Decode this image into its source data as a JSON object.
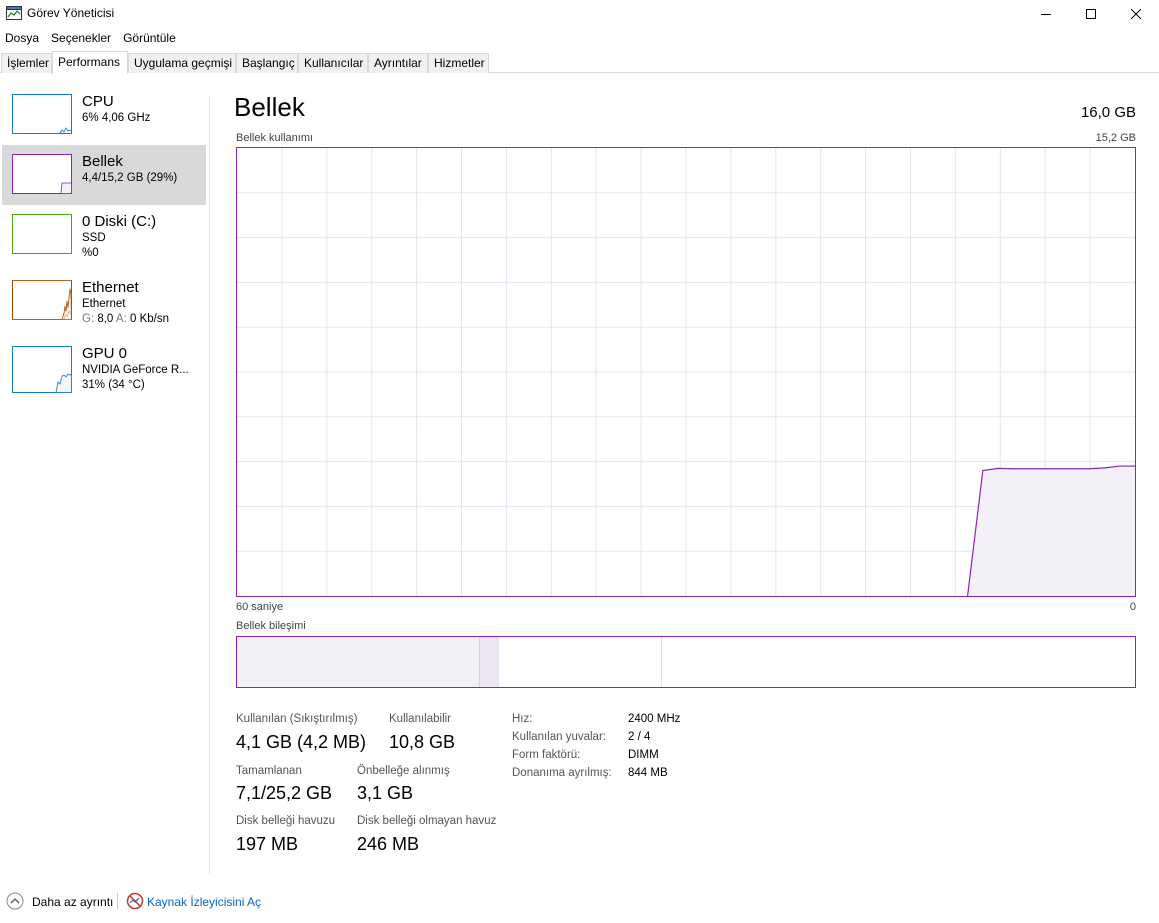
{
  "window": {
    "title": "Görev Yöneticisi"
  },
  "menu": [
    "Dosya",
    "Seçenekler",
    "Görüntüle"
  ],
  "tabs": [
    "İşlemler",
    "Performans",
    "Uygulama geçmişi",
    "Başlangıç",
    "Kullanıcılar",
    "Ayrıntılar",
    "Hizmetler"
  ],
  "active_tab": "Performans",
  "sidebar": {
    "cpu": {
      "title": "CPU",
      "line1": "6% 4,06 GHz",
      "color": "#117dbb"
    },
    "memory": {
      "title": "Bellek",
      "line1": "4,4/15,2 GB (29%)",
      "color": "#8b24b5"
    },
    "disk": {
      "title": "0 Diski (C:)",
      "line1": "SSD",
      "line2": "%0",
      "color": "#4da60c"
    },
    "ethernet": {
      "title": "Ethernet",
      "line1": "Ethernet",
      "send_label": "G:",
      "send_value": "8,0",
      "recv_label": "A:",
      "recv_value": "0 Kb/sn",
      "color": "#a74f01"
    },
    "gpu": {
      "title": "GPU 0",
      "line1": "NVIDIA GeForce R...",
      "line2": "31% (34 °C)",
      "color": "#117dbb"
    }
  },
  "main": {
    "title": "Bellek",
    "total": "16,0 GB",
    "usage_label": "Bellek kullanımı",
    "usage_max": "15,2 GB",
    "time_start": "60 saniye",
    "time_end": "0",
    "composition_label": "Bellek bileşimi",
    "accent": "#8b24b5",
    "usage_history_fraction": [
      0,
      0,
      0,
      0,
      0,
      0,
      0,
      0,
      0,
      0,
      0,
      0,
      0,
      0,
      0,
      0,
      0,
      0,
      0,
      0,
      0,
      0,
      0,
      0,
      0,
      0,
      0,
      0,
      0,
      0,
      0,
      0,
      0,
      0,
      0,
      0,
      0,
      0,
      0,
      0,
      0,
      0,
      0,
      0,
      0,
      0,
      0,
      0,
      0,
      0.28,
      0.285,
      0.284,
      0.284,
      0.284,
      0.284,
      0.284,
      0.284,
      0.286,
      0.29,
      0.29
    ]
  },
  "stats": {
    "in_use_label": "Kullanılan (Sıkıştırılmış)",
    "in_use_value": "4,1 GB (4,2 MB)",
    "available_label": "Kullanılabilir",
    "available_value": "10,8 GB",
    "committed_label": "Tamamlanan",
    "committed_value": "7,1/25,2 GB",
    "cached_label": "Önbelleğe alınmış",
    "cached_value": "3,1 GB",
    "paged_label": "Disk belleği havuzu",
    "paged_value": "197 MB",
    "nonpaged_label": "Disk belleği olmayan havuz",
    "nonpaged_value": "246 MB"
  },
  "info": {
    "speed_label": "Hız:",
    "speed_value": "2400 MHz",
    "slots_label": "Kullanılan yuvalar:",
    "slots_value": "2 / 4",
    "form_label": "Form faktörü:",
    "form_value": "DIMM",
    "reserved_label": "Donanıma ayrılmış:",
    "reserved_value": "844 MB"
  },
  "footer": {
    "less_details": "Daha az ayrıntı",
    "resource_monitor": "Kaynak İzleyicisini Aç"
  }
}
